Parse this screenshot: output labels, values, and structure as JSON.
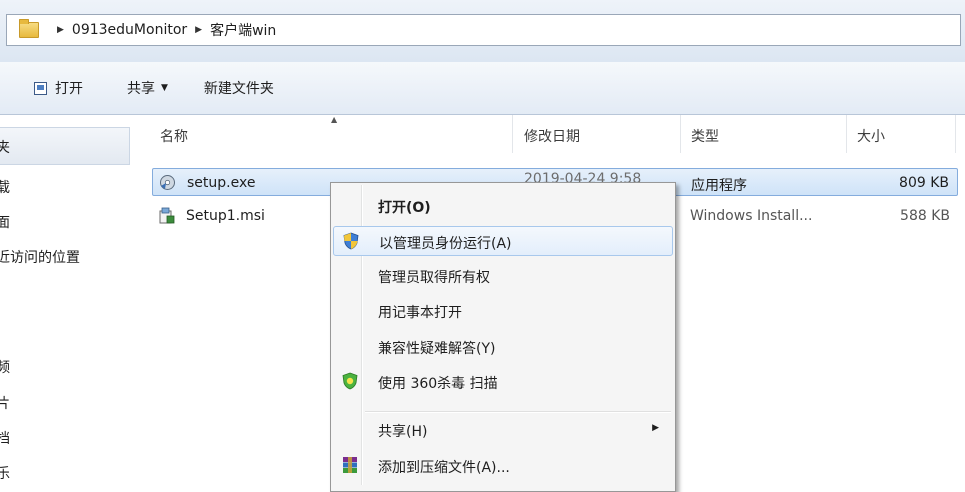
{
  "breadcrumb": {
    "items": [
      "0913eduMonitor",
      "客户端win"
    ],
    "separator": "▶"
  },
  "toolbar": {
    "open_label": "打开",
    "share_label": "共享",
    "share_caret": "▼",
    "new_folder_label": "新建文件夹"
  },
  "navigation": {
    "items": [
      "夹",
      "载",
      "面",
      "近访问的位置",
      "频",
      "片",
      "档",
      "乐"
    ]
  },
  "columns": {
    "name": "名称",
    "date": "修改日期",
    "type": "类型",
    "size": "大小",
    "sort_indicator": "▲"
  },
  "files": [
    {
      "name": "setup.exe",
      "date": "2019-04-24 9:58",
      "type": "应用程序",
      "size": "809 KB",
      "icon": "setup-exe-icon"
    },
    {
      "name": "Setup1.msi",
      "date": "",
      "type": "Windows Install...",
      "size": "588 KB",
      "icon": "msi-installer-icon"
    }
  ],
  "context_menu": {
    "items": [
      {
        "label": "打开(O)",
        "icon": ""
      },
      {
        "label": "以管理员身份运行(A)",
        "icon": "uac-shield-icon"
      },
      {
        "label": "管理员取得所有权",
        "icon": ""
      },
      {
        "label": "用记事本打开",
        "icon": ""
      },
      {
        "label": "兼容性疑难解答(Y)",
        "icon": ""
      },
      {
        "label": "使用 360杀毒 扫描",
        "icon": "360-antivirus-icon"
      },
      {
        "label": "共享(H)",
        "icon": "",
        "submenu_arrow": "▶"
      },
      {
        "label": "添加到压缩文件(A)...",
        "icon": "winrar-icon"
      }
    ]
  },
  "colors": {
    "selection_border": "#84acdd",
    "selection_fill": "#cfe3f8",
    "menu_background": "#f5f5f5"
  }
}
